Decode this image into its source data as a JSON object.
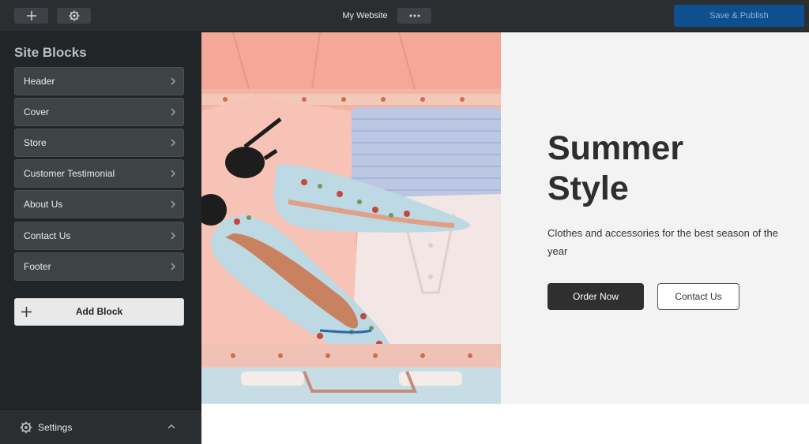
{
  "topbar": {
    "site_name": "My Website",
    "publish_label": "Save & Publish",
    "add_icon": "plus-icon",
    "settings_icon": "gear-icon",
    "more_icon": "ellipsis-icon"
  },
  "sidebar": {
    "title": "Site Blocks",
    "items": [
      {
        "label": "Header"
      },
      {
        "label": "Cover"
      },
      {
        "label": "Store"
      },
      {
        "label": "Customer Testimonial"
      },
      {
        "label": "About Us"
      },
      {
        "label": "Contact Us"
      },
      {
        "label": "Footer"
      }
    ],
    "add_block_label": "Add Block",
    "settings_label": "Settings"
  },
  "hero": {
    "title_line1": "Summer",
    "title_line2": "Style",
    "subtitle": "Clothes and accessories for the best season of the year",
    "primary_button": "Order Now",
    "secondary_button": "Contact Us",
    "image": "suitcase-shoes-photo"
  },
  "colors": {
    "topbar_bg": "#2b2e31",
    "sidebar_bg": "#222528",
    "publish_bg": "#0e4f8f",
    "hero_panel_bg": "#f3f3f3"
  }
}
